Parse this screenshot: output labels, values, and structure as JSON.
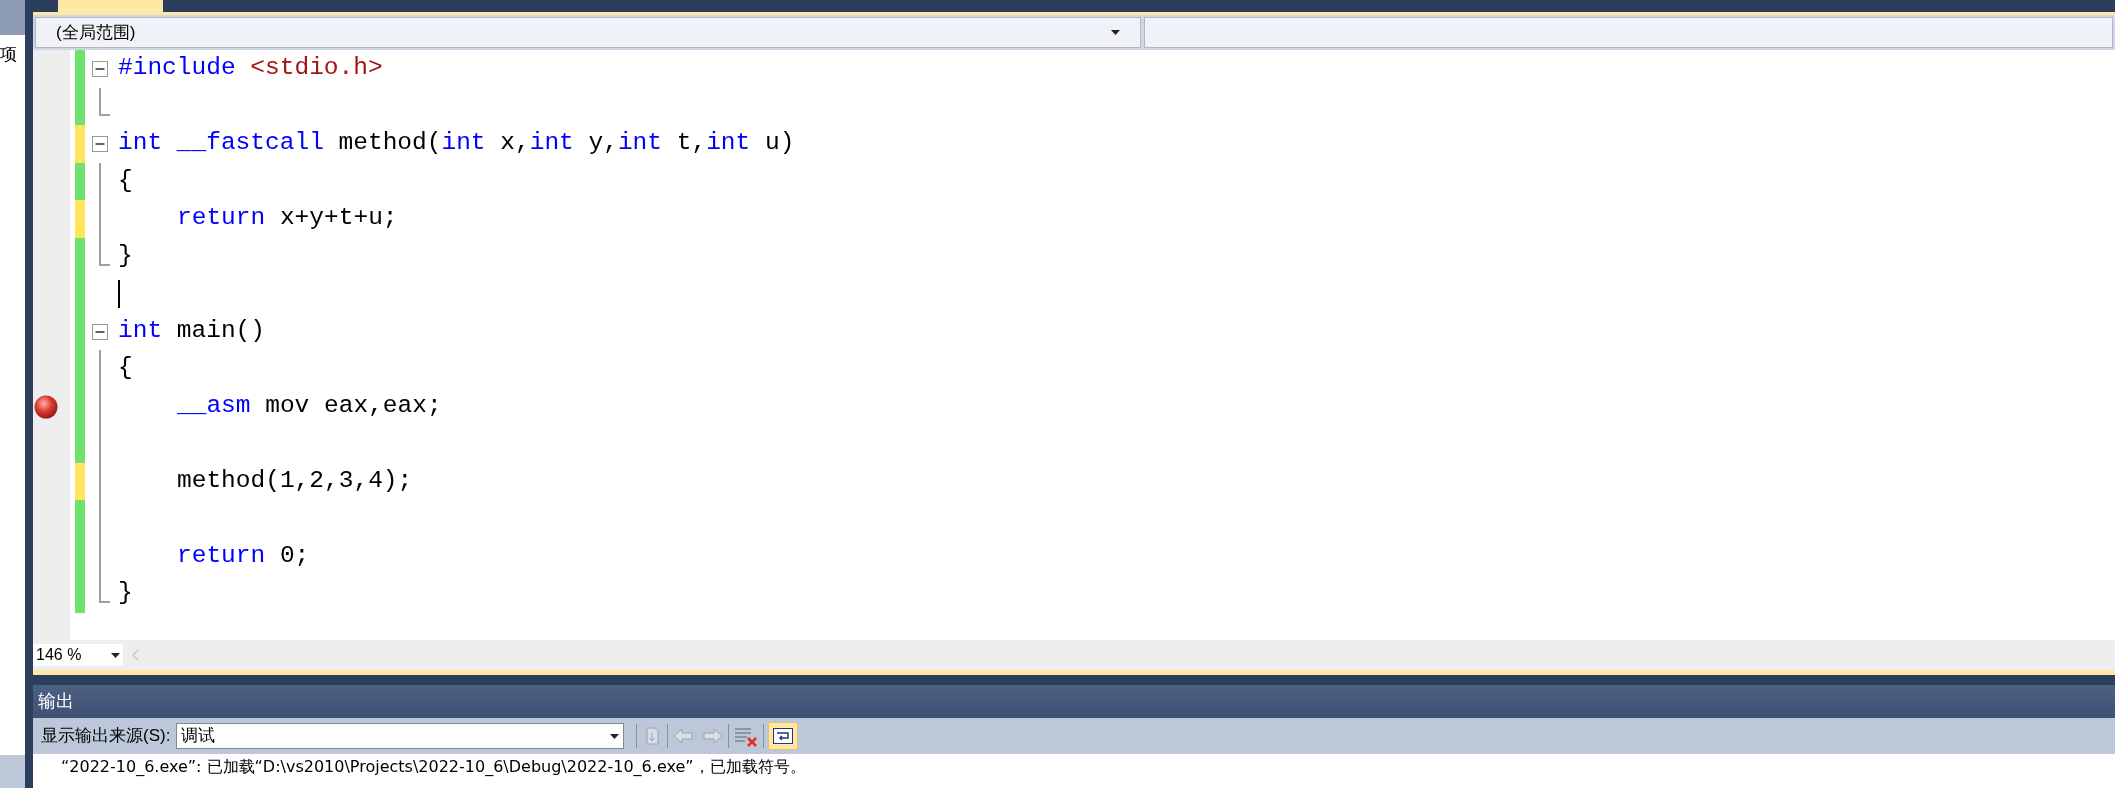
{
  "left_panel": {
    "label": "项"
  },
  "scope_bar": {
    "left_dropdown": "(全局范围)"
  },
  "editor": {
    "lines": [
      {
        "changed": false,
        "kind": "fold-start",
        "breakpoint": false,
        "caret": false,
        "indented": false,
        "tokens": [
          {
            "text": "#include ",
            "kind": "keyword"
          },
          {
            "text": "<stdio.h>",
            "kind": "string"
          }
        ]
      },
      {
        "changed": false,
        "kind": "fold-end",
        "breakpoint": false,
        "caret": false
      },
      {
        "changed": true,
        "kind": "fold-start",
        "breakpoint": false,
        "caret": false,
        "indented": false,
        "tokens": [
          {
            "text": "int",
            "kind": "keyword"
          },
          {
            "text": " __fastcall",
            "kind": "keyword"
          },
          {
            "text": " method(",
            "kind": "plain"
          },
          {
            "text": "int",
            "kind": "keyword"
          },
          {
            "text": " x,",
            "kind": "plain"
          },
          {
            "text": "int",
            "kind": "keyword"
          },
          {
            "text": " y,",
            "kind": "plain"
          },
          {
            "text": "int",
            "kind": "keyword"
          },
          {
            "text": " t,",
            "kind": "plain"
          },
          {
            "text": "int",
            "kind": "keyword"
          },
          {
            "text": " u)",
            "kind": "plain"
          }
        ]
      },
      {
        "changed": false,
        "kind": "fold-body",
        "breakpoint": false,
        "caret": false,
        "indented": false,
        "tokens": [
          {
            "text": "{",
            "kind": "plain"
          }
        ]
      },
      {
        "changed": true,
        "kind": "fold-body",
        "breakpoint": false,
        "caret": false,
        "indented": true,
        "tokens": [
          {
            "text": "return",
            "kind": "keyword"
          },
          {
            "text": " x+y+t+u;",
            "kind": "plain"
          }
        ]
      },
      {
        "changed": false,
        "kind": "fold-end",
        "breakpoint": false,
        "caret": false,
        "indented": false,
        "tokens": [
          {
            "text": "}",
            "kind": "plain"
          }
        ]
      },
      {
        "changed": false,
        "kind": "plain",
        "breakpoint": false,
        "caret": true,
        "indented": false
      },
      {
        "changed": false,
        "kind": "fold-start",
        "breakpoint": false,
        "caret": false,
        "indented": false,
        "tokens": [
          {
            "text": "int",
            "kind": "keyword"
          },
          {
            "text": " main()",
            "kind": "plain"
          }
        ]
      },
      {
        "changed": false,
        "kind": "fold-body",
        "breakpoint": false,
        "caret": false,
        "indented": false,
        "tokens": [
          {
            "text": "{",
            "kind": "plain"
          }
        ]
      },
      {
        "changed": false,
        "kind": "fold-body",
        "breakpoint": true,
        "caret": false,
        "indented": true,
        "tokens": [
          {
            "text": "__asm",
            "kind": "keyword"
          },
          {
            "text": " mov eax,eax;",
            "kind": "plain"
          }
        ]
      },
      {
        "changed": false,
        "kind": "fold-body",
        "breakpoint": false,
        "caret": false
      },
      {
        "changed": true,
        "kind": "fold-body",
        "breakpoint": false,
        "caret": false,
        "indented": true,
        "tokens": [
          {
            "text": "method(1,2,3,4);",
            "kind": "plain"
          }
        ]
      },
      {
        "changed": false,
        "kind": "fold-body",
        "breakpoint": false,
        "caret": false
      },
      {
        "changed": false,
        "kind": "fold-body",
        "breakpoint": false,
        "caret": false,
        "indented": true,
        "tokens": [
          {
            "text": "return",
            "kind": "keyword"
          },
          {
            "text": " 0;",
            "kind": "plain"
          }
        ]
      },
      {
        "changed": false,
        "kind": "fold-end",
        "breakpoint": false,
        "caret": false,
        "indented": false,
        "tokens": [
          {
            "text": "}",
            "kind": "plain"
          }
        ]
      }
    ]
  },
  "zoom": {
    "value": "146 %"
  },
  "output": {
    "title": "输出",
    "source_label": "显示输出来源(S):",
    "source": "调试",
    "lines": [
      "“2022-10_6.exe”: 已加载“D:\\vs2010\\Projects\\2022-10_6\\Debug\\2022-10_6.exe”，已加载符号。"
    ]
  }
}
